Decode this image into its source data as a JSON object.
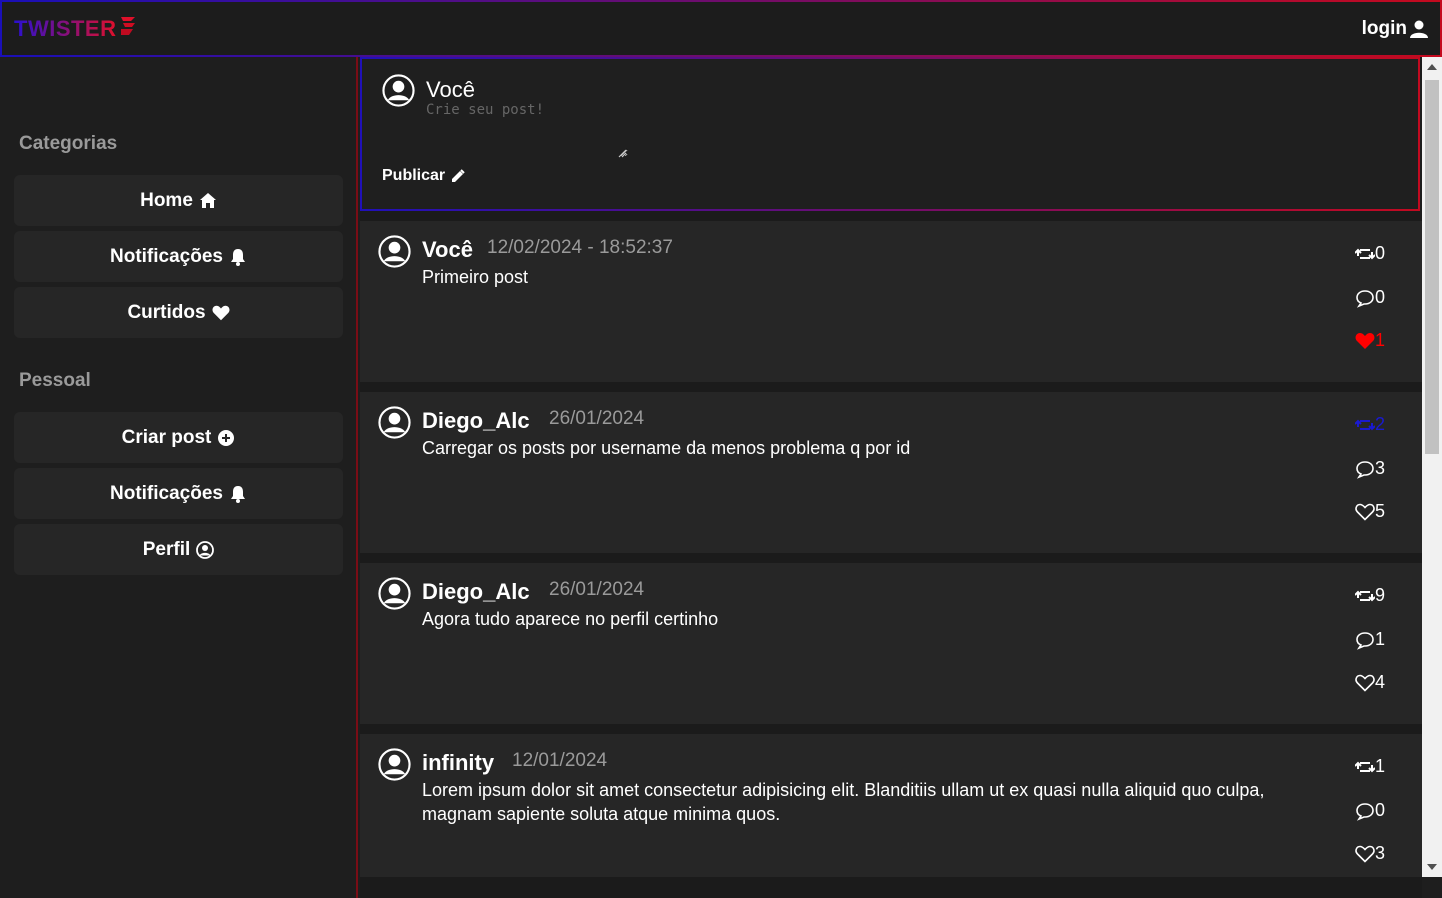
{
  "app": {
    "logo": "TWISTER",
    "login_label": "login"
  },
  "sidebar": {
    "categories_title": "Categorias",
    "categories": [
      {
        "label": "Home",
        "icon": "home-icon"
      },
      {
        "label": "Notificações",
        "icon": "bell-icon"
      },
      {
        "label": "Curtidos",
        "icon": "heart-icon"
      }
    ],
    "personal_title": "Pessoal",
    "personal": [
      {
        "label": "Criar post",
        "icon": "plus-circle-icon"
      },
      {
        "label": "Notificações",
        "icon": "bell-icon"
      },
      {
        "label": "Perfil",
        "icon": "user-circle-icon"
      }
    ]
  },
  "composer": {
    "author": "Você",
    "placeholder": "Crie seu post!",
    "publish_label": "Publicar"
  },
  "posts": [
    {
      "author": "Você",
      "date": "12/02/2024 - 18:52:37",
      "text": "Primeiro post",
      "retweets": "0",
      "comments": "0",
      "likes": "1",
      "liked": true,
      "retweeted": false
    },
    {
      "author": "Diego_Alc",
      "date": "26/01/2024",
      "text": "Carregar os posts por username da menos problema q por id",
      "retweets": "2",
      "comments": "3",
      "likes": "5",
      "liked": false,
      "retweeted": true
    },
    {
      "author": "Diego_Alc",
      "date": "26/01/2024",
      "text": "Agora tudo aparece no perfil certinho",
      "retweets": "9",
      "comments": "1",
      "likes": "4",
      "liked": false,
      "retweeted": false
    },
    {
      "author": "infinity",
      "date": "12/01/2024",
      "text": "Lorem ipsum dolor sit amet consectetur adipisicing elit. Blanditiis ullam ut ex quasi nulla aliquid quo culpa, magnam sapiente soluta atque minima quos.",
      "retweets": "1",
      "comments": "0",
      "likes": "3",
      "liked": false,
      "retweeted": false
    }
  ],
  "colors": {
    "accent_red": "#e0102a",
    "accent_blue": "#2a10d0",
    "liked": "#ff0000",
    "retweeted": "#1a1ad0"
  }
}
